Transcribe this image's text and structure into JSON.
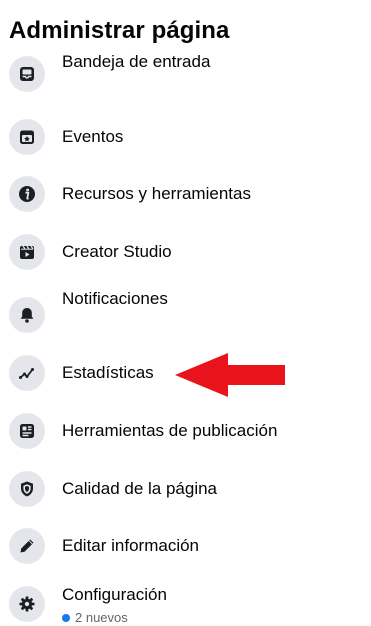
{
  "header": {
    "title": "Administrar página"
  },
  "menu": {
    "items": [
      {
        "label": "Bandeja de entrada",
        "icon": "inbox-icon"
      },
      {
        "label": "Eventos",
        "icon": "calendar-star-icon"
      },
      {
        "label": "Recursos y herramientas",
        "icon": "info-icon"
      },
      {
        "label": "Creator Studio",
        "icon": "clapperboard-icon"
      },
      {
        "label": "Notificaciones",
        "icon": "bell-icon"
      },
      {
        "label": "Estadísticas",
        "icon": "trend-line-icon"
      },
      {
        "label": "Herramientas de publicación",
        "icon": "publishing-tools-icon"
      },
      {
        "label": "Calidad de la página",
        "icon": "shield-icon"
      },
      {
        "label": "Editar información",
        "icon": "pencil-icon"
      },
      {
        "label": "Configuración",
        "icon": "gear-icon",
        "badge": "2 nuevos"
      }
    ]
  },
  "annotation": {
    "icon": "red-arrow-icon",
    "color": "#e8131b",
    "points_to": "Estadísticas"
  },
  "colors": {
    "icon_bg": "#e4e6eb",
    "badge_dot": "#1877f2",
    "text": "#050505",
    "secondary_text": "#65676b"
  }
}
